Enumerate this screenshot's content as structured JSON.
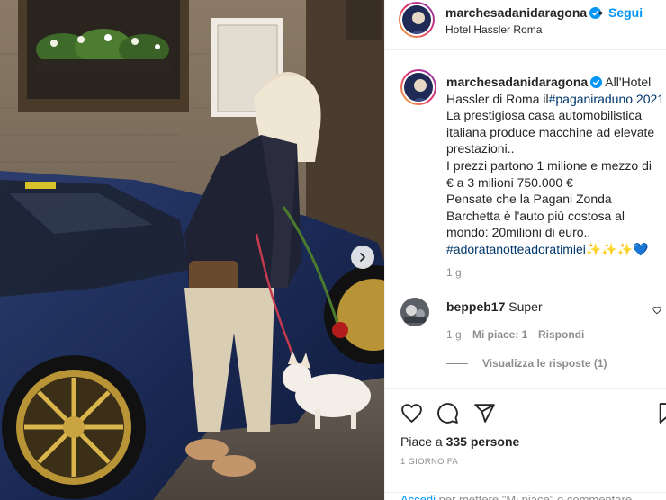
{
  "post": {
    "image_alt": "",
    "next_icon": "chevron-right-icon"
  },
  "header": {
    "username": "marchesadanidaragona",
    "separator": "•",
    "follow_label": "Segui",
    "location": "Hotel Hassler Roma"
  },
  "caption": {
    "username": "marchesadanidaragona",
    "lines": [
      "All'Hotel",
      "Hassler di Roma il",
      "#paganiraduno 2021",
      "La prestigiosa casa automobilistica",
      "italiana produce macchine ad elevate",
      "prestazioni..",
      "I prezzi partono 1 milione e mezzo di",
      "€ a 3 milioni 750.000 €",
      "Pensate che la Pagani Zonda",
      "Barchetta è l'auto più costosa al",
      "mondo: 20milioni di euro..",
      "#adoratanotteadoratimiei",
      "✨✨✨💙"
    ],
    "time": "1 g"
  },
  "comment": {
    "username": "beppeb17",
    "text": "Super",
    "time": "1 g",
    "likes": "Mi piace: 1",
    "reply": "Rispondi",
    "view_replies": "Visualizza le risposte (1)"
  },
  "actions": {
    "like_icon": "heart-icon",
    "comment_icon": "comment-icon",
    "share_icon": "share-icon",
    "save_icon": "bookmark-icon"
  },
  "likes": {
    "prefix": "Piace a ",
    "count": "335",
    "suffix": " persone"
  },
  "posted_ago": "1 GIORNO FA",
  "login_hint": {
    "link": "Accedi",
    "text": " per mettere \"Mi piace\" o commentare."
  },
  "colors": {
    "accent": "#0095f6",
    "hashtag": "#00376b",
    "muted": "#8e8e8e",
    "text": "#262626"
  }
}
